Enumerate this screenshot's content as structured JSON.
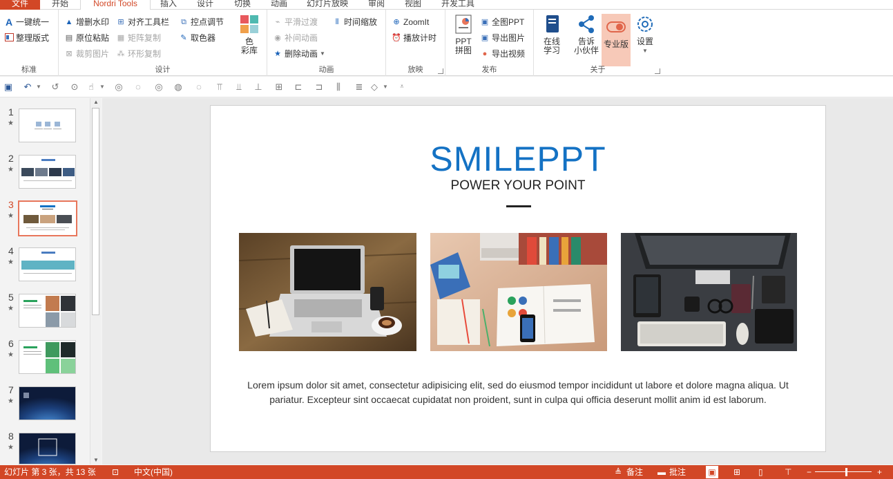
{
  "tabs": [
    {
      "label": "文件"
    },
    {
      "label": "开始"
    },
    {
      "label": "Nordri Tools"
    },
    {
      "label": "插入"
    },
    {
      "label": "设计"
    },
    {
      "label": "切换"
    },
    {
      "label": "动画"
    },
    {
      "label": "幻灯片放映"
    },
    {
      "label": "审阅"
    },
    {
      "label": "视图"
    },
    {
      "label": "开发工具"
    }
  ],
  "ribbon": {
    "standard": {
      "label": "标准",
      "unify": "一键统一",
      "format": "整理版式"
    },
    "design": {
      "label": "设计",
      "watermark": "增删水印",
      "align": "对齐工具栏",
      "adjust": "控点调节",
      "paste": "原位粘贴",
      "matrix": "矩阵复制",
      "picker": "取色器",
      "crop": "裁剪图片",
      "ring": "环形复制",
      "palette_line1": "色",
      "palette_line2": "彩库"
    },
    "animation": {
      "label": "动画",
      "smooth": "平滑过渡",
      "timescale": "时间缩放",
      "tween": "补间动画",
      "delete": "删除动画"
    },
    "show": {
      "label": "放映",
      "zoomit": "ZoomIt",
      "timer": "播放计时"
    },
    "publish": {
      "label": "发布",
      "ppt_line1": "PPT",
      "ppt_line2": "拼图",
      "full": "全图PPT",
      "export_img": "导出图片",
      "export_video": "导出视频"
    },
    "about": {
      "label": "关于",
      "learn_line1": "在线",
      "learn_line2": "学习",
      "tell_line1": "告诉",
      "tell_line2": "小伙伴",
      "pro": "专业版",
      "settings": "设置"
    }
  },
  "thumbnails": [
    {
      "num": "1",
      "star": "★"
    },
    {
      "num": "2",
      "star": "★"
    },
    {
      "num": "3",
      "star": "★"
    },
    {
      "num": "4",
      "star": "★"
    },
    {
      "num": "5",
      "star": "★"
    },
    {
      "num": "6",
      "star": "★"
    },
    {
      "num": "7",
      "star": "★"
    },
    {
      "num": "8",
      "star": "★"
    }
  ],
  "slide": {
    "title": "SMILEPPT",
    "subtitle": "POWER YOUR POINT",
    "body": "Lorem ipsum dolor sit amet, consectetur adipisicing elit, sed do eiusmod tempor incididunt ut labore et dolore magna aliqua. Ut pariatur. Excepteur sint occaecat cupidatat non proident, sunt in culpa qui officia deserunt mollit anim id est laborum."
  },
  "status": {
    "slide_info": "幻灯片 第 3 张，共 13 张",
    "language": "中文(中国)",
    "notes": "备注",
    "comments": "批注"
  },
  "colors": {
    "accent": "#d24726",
    "title_blue": "#1472c4"
  }
}
